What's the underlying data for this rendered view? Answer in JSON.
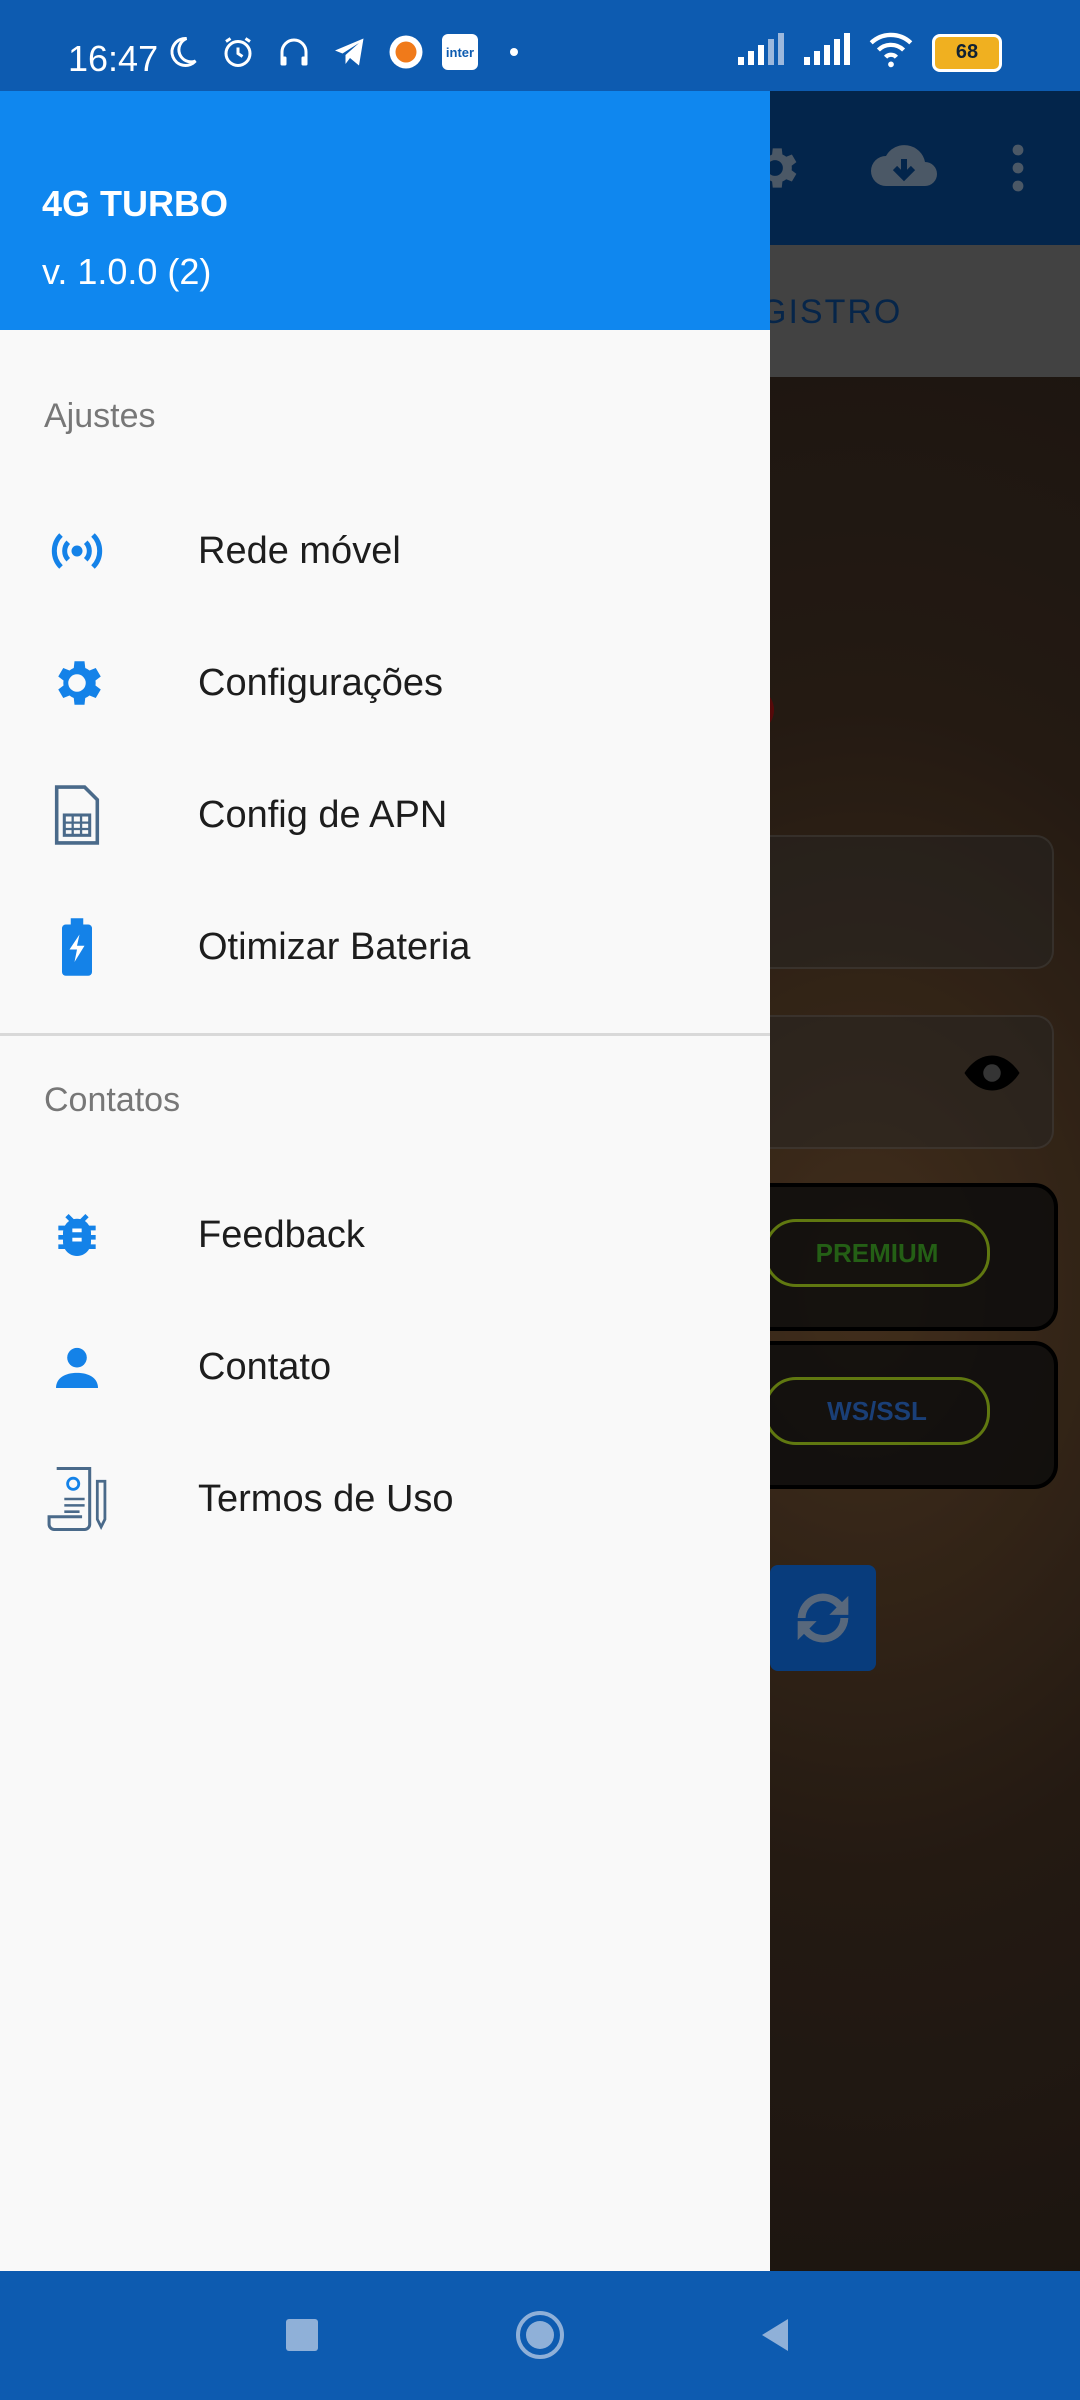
{
  "status_bar": {
    "time": "16:47",
    "battery": "68",
    "icons": [
      "moon-icon",
      "alarm-icon",
      "headphones-icon",
      "telegram-icon",
      "app-badge-icon",
      "inter-app-icon",
      "dot-icon"
    ],
    "inter_label": "inter"
  },
  "background_app": {
    "tab_text": "GISTRO",
    "premium_label": "PREMIUM",
    "ws_label": "WS/SSL"
  },
  "drawer": {
    "title": "4G TURBO",
    "version": "v. 1.0.0 (2)",
    "sections": [
      {
        "label": "Ajustes",
        "items": [
          {
            "label": "Rede móvel",
            "icon": "mobile-network-icon"
          },
          {
            "label": "Configurações",
            "icon": "gear-icon"
          },
          {
            "label": "Config de APN",
            "icon": "sim-card-icon"
          },
          {
            "label": "Otimizar Bateria",
            "icon": "battery-charging-icon"
          }
        ]
      },
      {
        "label": "Contatos",
        "items": [
          {
            "label": "Feedback",
            "icon": "bug-icon"
          },
          {
            "label": "Contato",
            "icon": "person-icon"
          },
          {
            "label": "Termos de Uso",
            "icon": "document-icon"
          }
        ]
      }
    ]
  },
  "colors": {
    "accent": "#0f87ef",
    "status_bar": "#0d5bb0",
    "app_toolbar": "#063d7a"
  }
}
